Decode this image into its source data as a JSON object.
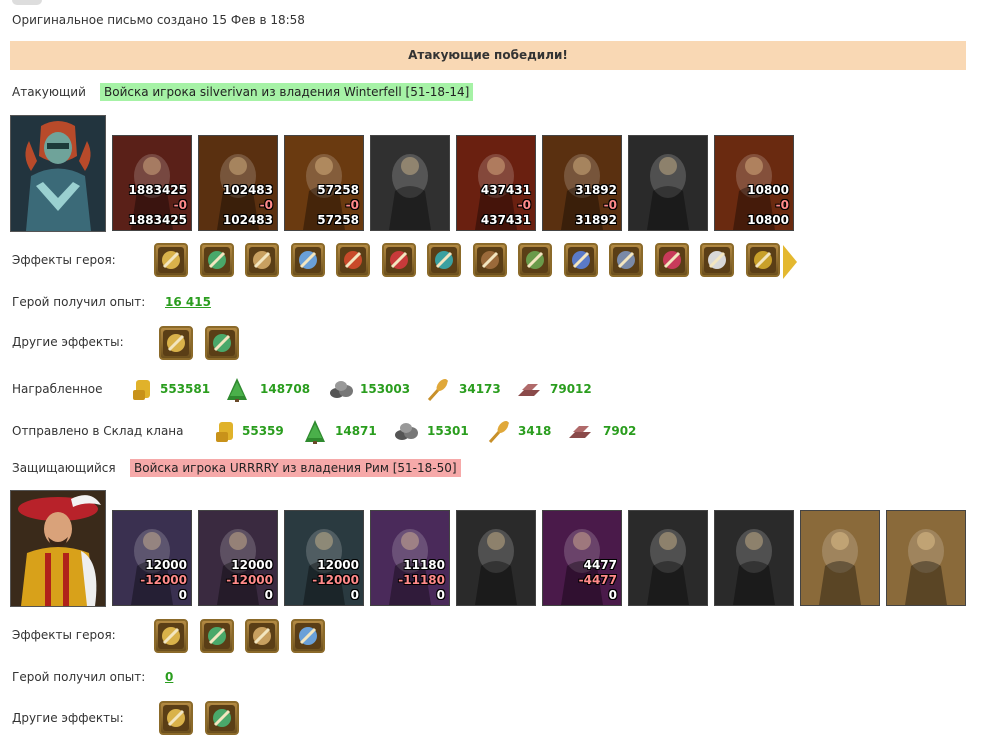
{
  "header": {
    "created": "Оригинальное письмо создано 15 Фев в 18:58"
  },
  "banner": {
    "result": "Атакующие победили!"
  },
  "attacker": {
    "role_label": "Атакующий",
    "owner": "Войска игрока silverivan из владения Winterfell [51-18-14]",
    "units": [
      {
        "icon": "red-dragon-icon",
        "top": "1883425",
        "mid": "-0",
        "bot": "1883425",
        "bg": "#5a2018"
      },
      {
        "icon": "flame-skeleton-icon",
        "top": "102483",
        "mid": "-0",
        "bot": "102483",
        "bg": "#5a3010"
      },
      {
        "icon": "fire-beast-icon",
        "top": "57258",
        "mid": "-0",
        "bot": "57258",
        "bg": "#6a3a10"
      },
      {
        "icon": "stone-gargoyle-icon",
        "top": "",
        "mid": "",
        "bot": "",
        "bg": "#303030"
      },
      {
        "icon": "fire-golem-icon",
        "top": "437431",
        "mid": "-0",
        "bot": "437431",
        "bg": "#6a2010"
      },
      {
        "icon": "flame-warrior-icon",
        "top": "31892",
        "mid": "-0",
        "bot": "31892",
        "bg": "#5a3010"
      },
      {
        "icon": "stone-knight-icon",
        "top": "",
        "mid": "",
        "bot": "",
        "bg": "#2a2a2a"
      },
      {
        "icon": "fire-demon-icon",
        "top": "10800",
        "mid": "-0",
        "bot": "10800",
        "bg": "#6a2a10"
      }
    ],
    "hero_effects_label": "Эффекты героя:",
    "hero_effects": [
      "gold-coins-icon",
      "sword-icon",
      "handshake-icon",
      "fist-icon",
      "tower-icon",
      "dice-icon",
      "shield-icon",
      "shield-hand-icon",
      "monk-icon",
      "amulet-icon",
      "armor-icon",
      "crossed-arrows-icon",
      "scroll-icon",
      "dagger-icon"
    ],
    "xp_label": "Герой получил опыт:",
    "xp_value": "16 415",
    "other_effects_label": "Другие эффекты:",
    "other_effects": [
      "sword-fist-icon",
      "gold-scroll-icon"
    ],
    "loot_label": "Награбленное",
    "loot": [
      {
        "icon": "gold-icon",
        "value": "553581"
      },
      {
        "icon": "wood-icon",
        "value": "148708"
      },
      {
        "icon": "ore-icon",
        "value": "153003"
      },
      {
        "icon": "grain-icon",
        "value": "34173"
      },
      {
        "icon": "iron-icon",
        "value": "79012"
      }
    ],
    "clan_label": "Отправлено в Склад клана",
    "clan": [
      {
        "icon": "gold-icon",
        "value": "55359"
      },
      {
        "icon": "wood-icon",
        "value": "14871"
      },
      {
        "icon": "ore-icon",
        "value": "15301"
      },
      {
        "icon": "grain-icon",
        "value": "3418"
      },
      {
        "icon": "iron-icon",
        "value": "7902"
      }
    ]
  },
  "defender": {
    "role_label": "Защищающийся",
    "owner": "Войска игрока URRRRY из владения Рим [51-18-50]",
    "units": [
      {
        "icon": "troll-icon",
        "top": "12000",
        "mid": "-12000",
        "bot": "0",
        "bg": "#3a3050"
      },
      {
        "icon": "dark-elf-icon",
        "top": "12000",
        "mid": "-12000",
        "bot": "0",
        "bg": "#3a2a40"
      },
      {
        "icon": "lizard-knight-icon",
        "top": "12000",
        "mid": "-12000",
        "bot": "0",
        "bg": "#2a3a40"
      },
      {
        "icon": "purple-dragon-icon",
        "top": "11180",
        "mid": "-11180",
        "bot": "0",
        "bg": "#4a2a5a"
      },
      {
        "icon": "stone-archer-icon",
        "top": "",
        "mid": "",
        "bot": "",
        "bg": "#2a2a2a"
      },
      {
        "icon": "sorceress-icon",
        "top": "4477",
        "mid": "-4477",
        "bot": "0",
        "bg": "#4a1a4a"
      },
      {
        "icon": "stone-assassin-icon",
        "top": "",
        "mid": "",
        "bot": "",
        "bg": "#2a2a2a"
      },
      {
        "icon": "stone-spider-icon",
        "top": "",
        "mid": "",
        "bot": "",
        "bg": "#2a2a2a"
      },
      {
        "icon": "orb-shrine-icon",
        "top": "",
        "mid": "",
        "bot": "",
        "bg": "#8a6a3a"
      },
      {
        "icon": "orb-shrine-icon",
        "top": "",
        "mid": "",
        "bot": "",
        "bg": "#8a6a3a"
      }
    ],
    "hero_effects_label": "Эффекты героя:",
    "hero_effects": [
      "hood-icon",
      "armor-icon",
      "scroll-icon",
      "bow-icon"
    ],
    "xp_label": "Герой получил опыт:",
    "xp_value": "0",
    "other_effects_label": "Другие эффекты:",
    "other_effects": [
      "sword-fist-icon",
      "heart-sword-icon"
    ]
  },
  "colors": {
    "banner_bg": "#f9d8b4",
    "attacker_owner_bg": "#a6f2a6",
    "defender_owner_bg": "#f6a9a9",
    "value_green": "#2a9d1e"
  }
}
